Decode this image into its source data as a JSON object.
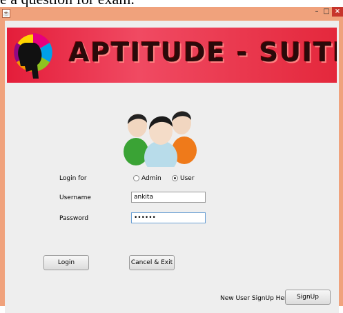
{
  "background_text": "e a question for exam.",
  "window": {
    "minimize_glyph": "–",
    "maximize_glyph": "□",
    "close_glyph": "×"
  },
  "banner": {
    "title": "APTITUDE - SUITE",
    "colors": {
      "bg": "#e41d3a",
      "title": "#2a0a0a"
    }
  },
  "form": {
    "login_for_label": "Login for",
    "radio_admin_label": "Admin",
    "radio_user_label": "User",
    "selected_role": "User",
    "username_label": "Username",
    "username_value": "ankita",
    "password_label": "Password",
    "password_value": "••••••"
  },
  "buttons": {
    "login": "Login",
    "cancel_exit": "Cancel & Exit",
    "signup": "SignUp"
  },
  "signup_prompt": "New User SignUp Here",
  "icons": {
    "app": "java-cup-icon",
    "logo": "head-gear-logo-icon",
    "users": "users-group-icon"
  }
}
